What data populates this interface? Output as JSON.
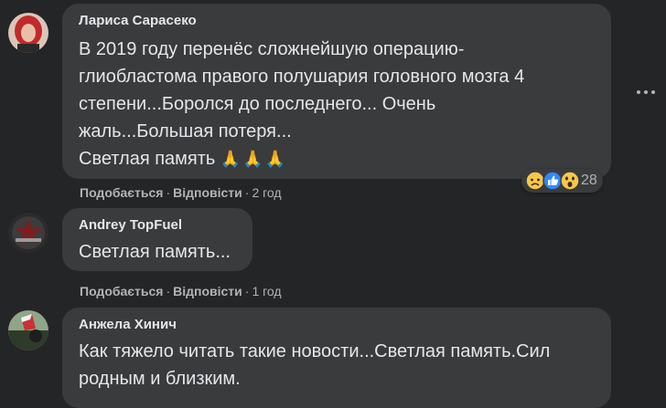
{
  "comments": [
    {
      "author": "Лариса Сарасеко",
      "line1": "В 2019 году перенёс сложнейшую операцию-",
      "line2": "глиобластома правого полушария головного мозга 4",
      "line3": "степени...Боролся до последнего... Очень",
      "line4": "жаль...Большая потеря...",
      "line5": "Светлая память",
      "emoji": "🙏🙏🙏",
      "like_label": "Подобається",
      "reply_label": "Відповісти",
      "time": "2 год",
      "reaction_count": "28",
      "reaction_icons": [
        "sad-reaction-icon",
        "like-reaction-icon",
        "wow-reaction-icon"
      ]
    },
    {
      "author": "Andrey TopFuel",
      "line1": "Светлая память...",
      "like_label": "Подобається",
      "reply_label": "Відповісти",
      "time": "1 год"
    },
    {
      "author": "Анжела Хинич",
      "line1": "Как тяжело читать такие новости...Светлая память.Сил",
      "line2": "родным и близким.",
      "sep": "·"
    }
  ],
  "separator": "·",
  "colors": {
    "background": "#242526",
    "bubble": "#3a3b3c",
    "text": "#e4e6eb",
    "secondary": "#b0b3b8",
    "like_blue": "#2e89ff"
  }
}
